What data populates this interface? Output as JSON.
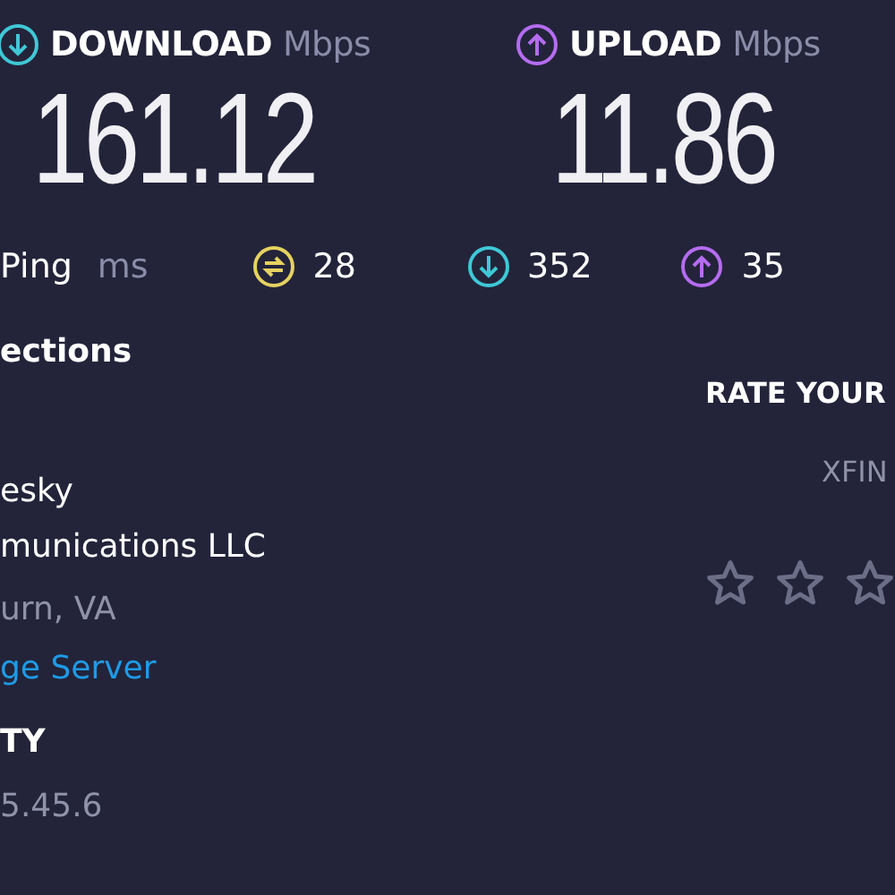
{
  "speeds": [
    {
      "kind": "download",
      "label": "DOWNLOAD",
      "unit": "Mbps",
      "value": "161.12"
    },
    {
      "kind": "upload",
      "label": "UPLOAD",
      "unit": "Mbps",
      "value": "11.86"
    }
  ],
  "ping": {
    "label": "Ping",
    "unit": "ms",
    "metrics": [
      {
        "kind": "idle",
        "value": "28"
      },
      {
        "kind": "download",
        "value": "352"
      },
      {
        "kind": "upload",
        "value": "35"
      }
    ]
  },
  "connections": {
    "heading": "ections",
    "isp_name": [
      "esky",
      "munications LLC"
    ],
    "location": "urn, VA",
    "server_link": "ge Server",
    "ip_heading": "TY",
    "ip": "5.45.6"
  },
  "rating": {
    "heading": "RATE YOUR",
    "provider": "XFIN",
    "stars": 0
  }
}
